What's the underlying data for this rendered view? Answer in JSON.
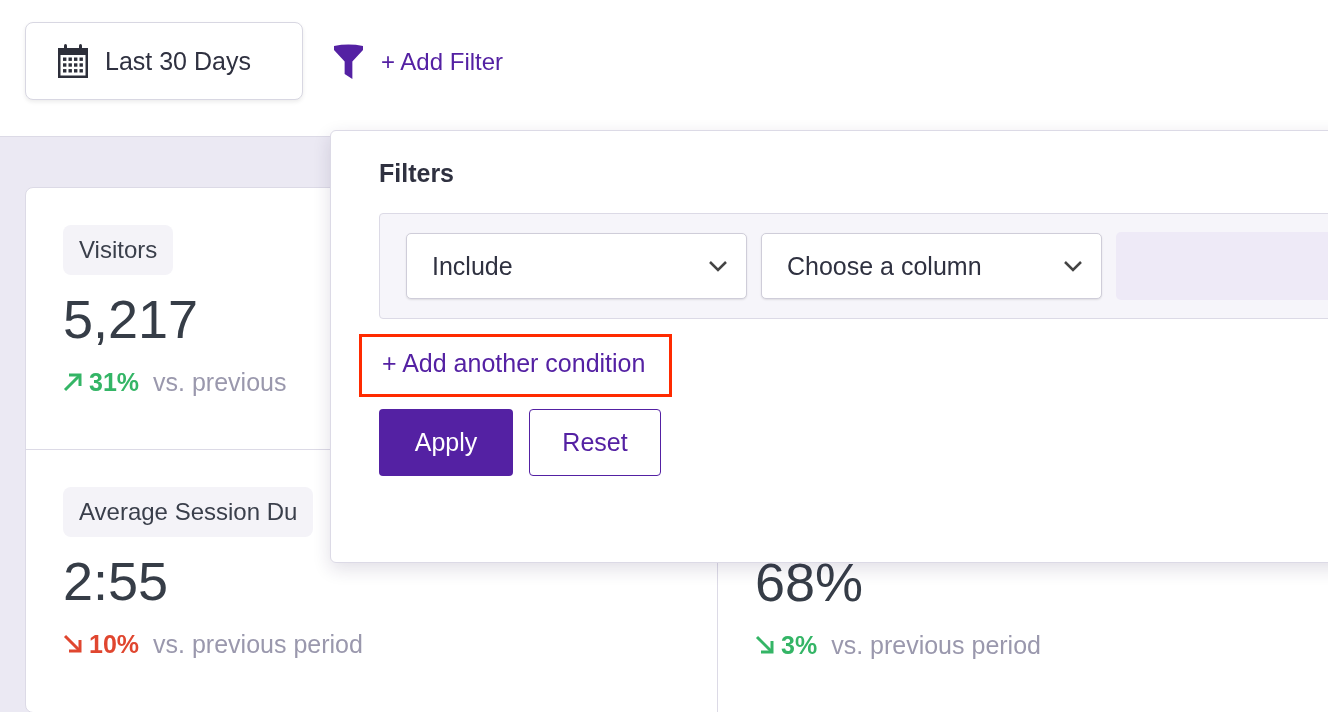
{
  "date_button": {
    "label": "Last 30 Days"
  },
  "add_filter": {
    "label": "+ Add Filter"
  },
  "stats": [
    {
      "label": "Visitors",
      "value": "5,217",
      "rising": true,
      "color": "#34b566",
      "change": "31%",
      "comparison": "vs. previous"
    },
    {
      "label": "Average Session Du",
      "value": "2:55",
      "rising": false,
      "color": "#e0462f",
      "change": "10%",
      "comparison": "vs. previous period"
    },
    {
      "value": "68%",
      "rising": false,
      "color": "#34b566",
      "change": "3%",
      "comparison": "vs. previous period"
    }
  ],
  "filter_panel": {
    "title": "Filters",
    "conditions": [
      {
        "mode": "Include",
        "column": "Choose a column"
      }
    ],
    "add_condition": "+ Add another condition",
    "highlighted": true,
    "buttons": [
      {
        "label": "Apply",
        "kind": "primary"
      },
      {
        "label": "Reset",
        "kind": "secondary"
      }
    ]
  }
}
